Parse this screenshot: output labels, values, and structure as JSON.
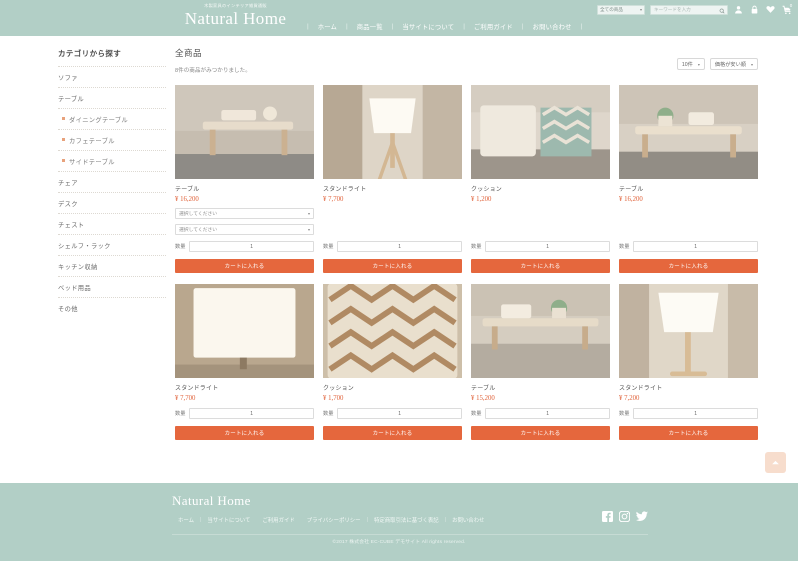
{
  "header": {
    "tagline": "木製家具のインテリア雑貨通販",
    "brand": "Natural Home",
    "nav": [
      {
        "label": "ホーム"
      },
      {
        "label": "商品一覧"
      },
      {
        "label": "当サイトについて"
      },
      {
        "label": "ご利用ガイド"
      },
      {
        "label": "お問い合わせ"
      }
    ],
    "category_select": "全ての商品",
    "search_placeholder": "キーワードを入力",
    "cart_count": "0",
    "icons": [
      "user-icon",
      "lock-icon",
      "heart-icon",
      "cart-icon"
    ]
  },
  "sidebar": {
    "title": "カテゴリから探す",
    "items": [
      {
        "label": "ソファ",
        "sub": false
      },
      {
        "label": "テーブル",
        "sub": false
      },
      {
        "label": "ダイニングテーブル",
        "sub": true
      },
      {
        "label": "カフェテーブル",
        "sub": true
      },
      {
        "label": "サイドテーブル",
        "sub": true
      },
      {
        "label": "チェア",
        "sub": false
      },
      {
        "label": "デスク",
        "sub": false
      },
      {
        "label": "チェスト",
        "sub": false
      },
      {
        "label": "シェルフ・ラック",
        "sub": false
      },
      {
        "label": "キッチン収納",
        "sub": false
      },
      {
        "label": "ベッド用品",
        "sub": false
      },
      {
        "label": "その他",
        "sub": false
      }
    ]
  },
  "main": {
    "title": "全商品",
    "count_text": "8件の商品がみつかりました。",
    "per_page": "10件",
    "sort": "価格が安い順",
    "qty_label": "数量",
    "cart_button": "カートに入れる",
    "option_placeholder": "選択してください",
    "products": [
      {
        "name": "テーブル",
        "price": "¥ 16,200",
        "qty": "1",
        "options": 2,
        "image": "table-tray"
      },
      {
        "name": "スタンドライト",
        "price": "¥ 7,700",
        "qty": "1",
        "options": 0,
        "image": "lamp"
      },
      {
        "name": "クッション",
        "price": "¥ 1,200",
        "qty": "1",
        "options": 0,
        "image": "cushion"
      },
      {
        "name": "テーブル",
        "price": "¥ 16,200",
        "qty": "1",
        "options": 0,
        "image": "table-plant"
      },
      {
        "name": "スタンドライト",
        "price": "¥ 7,700",
        "qty": "1",
        "options": 0,
        "image": "lamp-dark"
      },
      {
        "name": "クッション",
        "price": "¥ 1,700",
        "qty": "1",
        "options": 0,
        "image": "cushion-zigzag"
      },
      {
        "name": "テーブル",
        "price": "¥ 15,200",
        "qty": "1",
        "options": 0,
        "image": "table-rug"
      },
      {
        "name": "スタンドライト",
        "price": "¥ 7,200",
        "qty": "1",
        "options": 0,
        "image": "lamp-wood"
      }
    ]
  },
  "footer": {
    "brand": "Natural Home",
    "nav": [
      {
        "label": "ホーム"
      },
      {
        "label": "当サイトについて"
      },
      {
        "label": "ご利用ガイド"
      },
      {
        "label": "プライバシーポリシー"
      },
      {
        "label": "特定商取引法に基づく表記"
      },
      {
        "label": "お問い合わせ"
      }
    ],
    "social": [
      "facebook-icon",
      "instagram-icon",
      "twitter-icon"
    ],
    "copyright": "©2017 株式会社 EC-CUBE デモサイト All rights reserved."
  },
  "colors": {
    "brand_green": "#b2cfc6",
    "accent_orange": "#e5673d",
    "price_orange": "#e0623a",
    "to_top_peach": "#f7ddcd"
  }
}
